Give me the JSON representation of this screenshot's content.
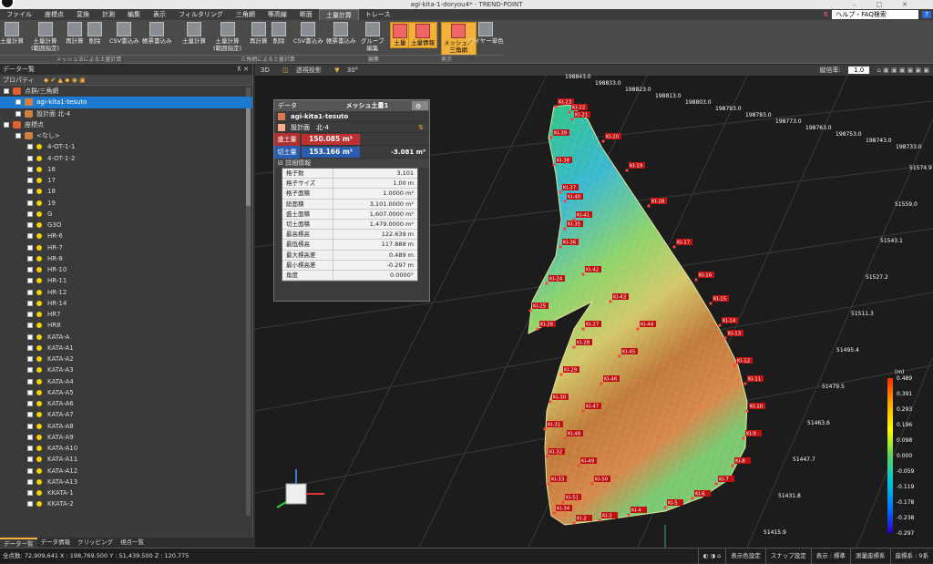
{
  "window": {
    "title": "agi-kita-1-doryou4* - TREND-POINT"
  },
  "menu": {
    "items": [
      "ファイル",
      "座標点",
      "変換",
      "計測",
      "編集",
      "表示",
      "フィルタリング",
      "三角網",
      "等高線",
      "断面",
      "土量計算",
      "トレース"
    ],
    "active": "土量計算",
    "help_label": "ヘルプ・FAQ検索"
  },
  "ribbon": {
    "buttons": [
      "土量計算",
      "土量計算\n(範囲指定)",
      "再計算",
      "削除",
      "CSV書込み",
      "帳票書込み",
      "土量計算",
      "土量計算\n(範囲指定)",
      "再計算",
      "削除",
      "CSV書込み",
      "帳票書込み",
      "グループ\n編集",
      "土量",
      "土量情報",
      "メッシュ／\n三角網",
      "ワイヤー単色"
    ],
    "groups": [
      "メッシュ法による土量計算",
      "三角網による土量計算",
      "編集",
      "表示"
    ]
  },
  "left_panel": {
    "title": "データ一覧",
    "property_label": "プロパティ",
    "tree": [
      {
        "label": "点群/三角網",
        "level": 0
      },
      {
        "label": "agi-kita1-tesuto",
        "level": 1,
        "selected": true
      },
      {
        "label": "設計面 北-4",
        "level": 1
      },
      {
        "label": "座標点",
        "level": 0
      },
      {
        "label": "<なし>",
        "level": 1
      },
      {
        "label": "4-OT-1-1",
        "level": 2
      },
      {
        "label": "4-OT-1-2",
        "level": 2
      },
      {
        "label": "16",
        "level": 2
      },
      {
        "label": "17",
        "level": 2
      },
      {
        "label": "18",
        "level": 2
      },
      {
        "label": "19",
        "level": 2
      },
      {
        "label": "G",
        "level": 2
      },
      {
        "label": "G3O",
        "level": 2
      },
      {
        "label": "HR-6",
        "level": 2
      },
      {
        "label": "HR-7",
        "level": 2
      },
      {
        "label": "HR-8",
        "level": 2
      },
      {
        "label": "HR-10",
        "level": 2
      },
      {
        "label": "HR-11",
        "level": 2
      },
      {
        "label": "HR-12",
        "level": 2
      },
      {
        "label": "HR-14",
        "level": 2
      },
      {
        "label": "HR7",
        "level": 2
      },
      {
        "label": "HR8",
        "level": 2
      },
      {
        "label": "KATA-A",
        "level": 2
      },
      {
        "label": "KATA-A1",
        "level": 2
      },
      {
        "label": "KATA-A2",
        "level": 2
      },
      {
        "label": "KATA-A3",
        "level": 2
      },
      {
        "label": "KATA-A4",
        "level": 2
      },
      {
        "label": "KATA-A5",
        "level": 2
      },
      {
        "label": "KATA-A6",
        "level": 2
      },
      {
        "label": "KATA-A7",
        "level": 2
      },
      {
        "label": "KATA-A8",
        "level": 2
      },
      {
        "label": "KATA-A9",
        "level": 2
      },
      {
        "label": "KATA-A10",
        "level": 2
      },
      {
        "label": "KATA-A11",
        "level": 2
      },
      {
        "label": "KATA-A12",
        "level": 2
      },
      {
        "label": "KATA-A13",
        "level": 2
      },
      {
        "label": "KKATA-1",
        "level": 2
      },
      {
        "label": "KKATA-2",
        "level": 2
      }
    ],
    "tabs": [
      "データ一覧",
      "データ情報",
      "クリッピング",
      "視点一覧"
    ]
  },
  "viewport": {
    "toolbar": {
      "mode": "3D",
      "projection": "透視投影",
      "angle": "30°",
      "vertical_ratio_label": "縦倍率:",
      "vertical_ratio": "1.0"
    },
    "panel": {
      "col1": "データ",
      "col2": "メッシュ土量1",
      "surface": "agi-kita1-tesuto",
      "design": "設計面　北-4",
      "fill_label": "盛土量",
      "fill_value": "150.085 m³",
      "cut_label": "切土量",
      "cut_value": "153.166 m³",
      "net_value": "-3.081 m³",
      "detail_label": "詳細情報",
      "details": [
        {
          "k": "格子数",
          "v": "3,101"
        },
        {
          "k": "格子サイズ",
          "v": "1.00 m"
        },
        {
          "k": "格子面積",
          "v": "1.0000 m²"
        },
        {
          "k": "総面積",
          "v": "3,101.0000 m²"
        },
        {
          "k": "盛土面積",
          "v": "1,607.0000 m²"
        },
        {
          "k": "切土面積",
          "v": "1,479.0000 m²"
        },
        {
          "k": "最高標高",
          "v": "122.639 m"
        },
        {
          "k": "最低標高",
          "v": "117.888 m"
        },
        {
          "k": "最大標高差",
          "v": "0.489 m"
        },
        {
          "k": "最小標高差",
          "v": "-0.297 m"
        },
        {
          "k": "角度",
          "v": "0.0000°"
        }
      ]
    },
    "top_coords": [
      "198843.0",
      "198833.0",
      "198823.0",
      "198813.0",
      "198803.0",
      "198793.0",
      "198783.0",
      "198773.0",
      "198763.0",
      "198753.0",
      "198743.0",
      "198733.0"
    ],
    "right_coords": [
      "51574.9",
      "51559.0",
      "51543.1",
      "51527.2",
      "51511.3",
      "51495.4",
      "51479.5",
      "51463.6",
      "51447.7",
      "51431.8",
      "51415.9"
    ],
    "legend": {
      "unit": "(m)",
      "ticks": [
        "0.489",
        "0.391",
        "0.293",
        "0.196",
        "0.098",
        "0.000",
        "-0.059",
        "-0.119",
        "-0.178",
        "-0.238",
        "-0.297"
      ]
    },
    "point_labels": [
      "KI-23",
      "KI-22",
      "KI-21",
      "KI-20",
      "KI-19",
      "KI-18",
      "KI-17",
      "KI-16",
      "KI-15",
      "KI-14",
      "KI-13",
      "KI-12",
      "KI-11",
      "KI-10",
      "KI-9",
      "KI-8",
      "KI-7",
      "KI-6",
      "KI-5",
      "KI-4",
      "KI-3",
      "KI-2",
      "KI-34",
      "KI-33",
      "KI-32",
      "KI-31",
      "KI-30",
      "KI-29",
      "KI-28",
      "KI-27",
      "KI-26",
      "KI-25",
      "KI-24",
      "KI-36",
      "KI-35",
      "KI-37",
      "KI-38",
      "KI-39",
      "KI-40",
      "KI-41",
      "KI-42",
      "KI-43",
      "KI-44",
      "KI-45",
      "KI-46",
      "KI-47",
      "KI-48",
      "KI-49",
      "KI-50",
      "KI-51"
    ]
  },
  "status": {
    "count": "全点数: 72,909,641",
    "coords": "X : 198,769.500 Y : 51,439.500 Z : 120.775",
    "color_setting": "表示色設定",
    "snap": "スナップ設定",
    "display": "表示 : 標準",
    "survey": "測量座標系",
    "system": "座標系 : 9系"
  }
}
